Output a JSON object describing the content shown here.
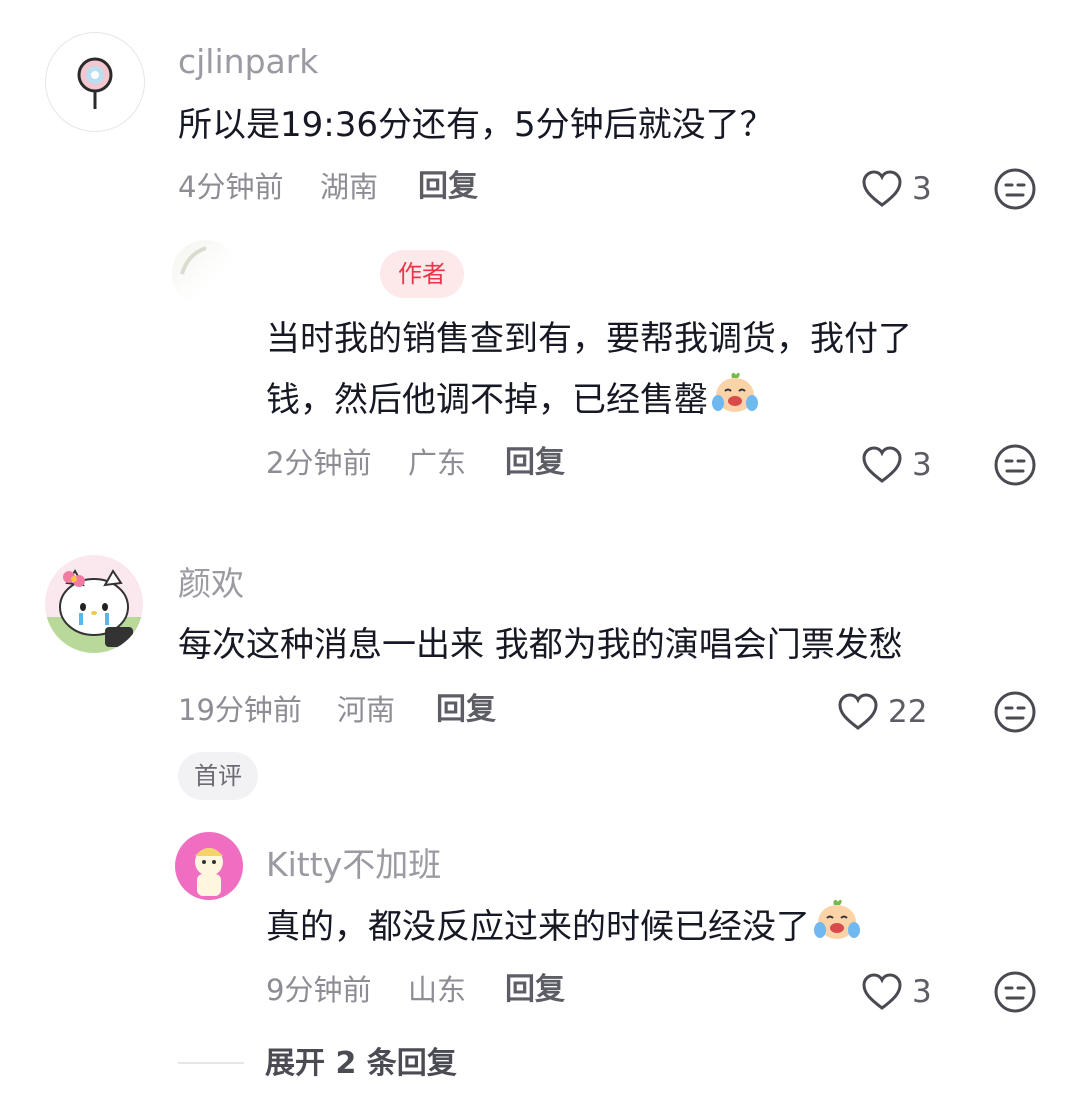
{
  "comments": [
    {
      "username": "cjlinpark",
      "text": "所以是19:36分还有，5分钟后就没了？",
      "time": "4分钟前",
      "location": "湖南",
      "reply_label": "回复",
      "likes": "3",
      "avatar_icon": "lollipop-icon",
      "replies": [
        {
          "username": "",
          "badge": "作者",
          "text_line1": "当时我的销售查到有，要帮我调货，我付了",
          "text_line2": "钱，然后他调不掉，已经售罄",
          "emoji": "crying-laughing-emoji",
          "time": "2分钟前",
          "location": "广东",
          "reply_label": "回复",
          "likes": "3"
        }
      ]
    },
    {
      "username": "颜欢",
      "text": "每次这种消息一出来 我都为我的演唱会门票发愁",
      "time": "19分钟前",
      "location": "河南",
      "reply_label": "回复",
      "likes": "22",
      "tag": "首评",
      "avatar_icon": "hello-kitty-icon",
      "replies": [
        {
          "username": "Kitty不加班",
          "text": "真的，都没反应过来的时候已经没了",
          "emoji": "crying-laughing-emoji",
          "time": "9分钟前",
          "location": "山东",
          "reply_label": "回复",
          "likes": "3"
        }
      ],
      "expand_label": "展开 2 条回复"
    }
  ],
  "colors": {
    "text": "#161823",
    "muted": "#8d8d95",
    "author_badge_bg": "#fde8ea",
    "author_badge_text": "#e8364a"
  }
}
